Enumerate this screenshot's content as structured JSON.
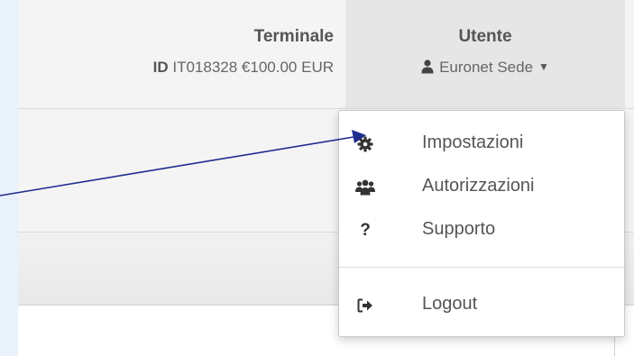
{
  "header": {
    "terminal": {
      "title": "Terminale",
      "id_label": "ID",
      "id_value": "IT018328 €100.00 EUR"
    },
    "user": {
      "title": "Utente",
      "name": "Euronet Sede"
    }
  },
  "user_menu": {
    "items": [
      {
        "label": "Impostazioni",
        "icon": "gear-icon"
      },
      {
        "label": "Autorizzazioni",
        "icon": "users-icon"
      },
      {
        "label": "Supporto",
        "icon": "question-icon",
        "glyph": "?"
      },
      {
        "label": "Logout",
        "icon": "sign-out-icon"
      }
    ]
  },
  "colors": {
    "page_background": "#e9f1fa",
    "header_background": "#f4f4f4",
    "user_header_background": "#e6e6e6",
    "text": "#555555",
    "annotation_arrow": "#1f2d8f"
  }
}
